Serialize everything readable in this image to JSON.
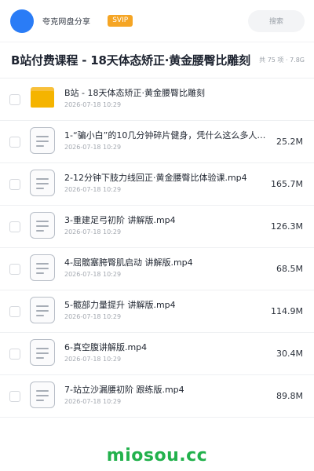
{
  "header": {
    "brand": "夸克网盘分享",
    "badge": "SVIP",
    "search_label": "搜索"
  },
  "folder": {
    "title": "B站付费课程 - 18天体态矫正·黄金腰臀比雕刻",
    "meta": "共 75 项 · 7.8G"
  },
  "items": [
    {
      "type": "folder",
      "name": "B站 - 18天体态矫正·黄金腰臀比雕刻",
      "date": "2026-07-18 10:29",
      "size": ""
    },
    {
      "type": "file",
      "name": "1-“骗小白”的10几分钟碎片健身，凭什么这么多人…",
      "date": "2026-07-18 10:29",
      "size": "25.2M"
    },
    {
      "type": "file",
      "name": "2-12分钟下肢力线回正·黄金腰臀比体验课.mp4",
      "date": "2026-07-18 10:29",
      "size": "165.7M"
    },
    {
      "type": "file",
      "name": "3-重建足弓初阶 讲解版.mp4",
      "date": "2026-07-18 10:29",
      "size": "126.3M"
    },
    {
      "type": "file",
      "name": "4-屈髋塞胯臀肌启动 讲解版.mp4",
      "date": "2026-07-18 10:29",
      "size": "68.5M"
    },
    {
      "type": "file",
      "name": "5-髋部力量提升 讲解版.mp4",
      "date": "2026-07-18 10:29",
      "size": "114.9M"
    },
    {
      "type": "file",
      "name": "6-真空腹讲解版.mp4",
      "date": "2026-07-18 10:29",
      "size": "30.4M"
    },
    {
      "type": "file",
      "name": "7-站立沙漏腰初阶 跟练版.mp4",
      "date": "2026-07-18 10:29",
      "size": "89.8M"
    }
  ],
  "watermark": "miosou.cc",
  "colors": {
    "accent": "#2a7cf6",
    "badge": "#f5a524",
    "folder": "#f5b400",
    "watermark": "#22b14c"
  }
}
